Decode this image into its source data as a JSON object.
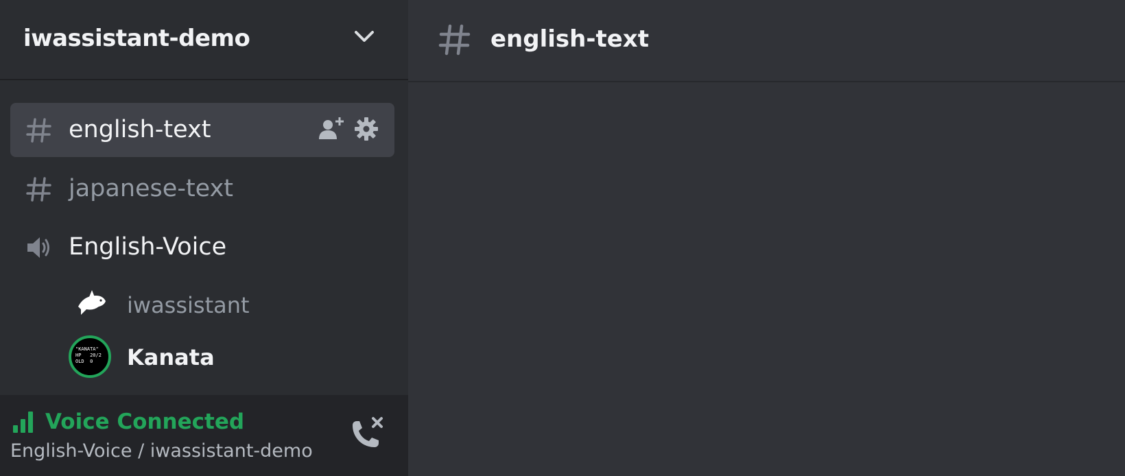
{
  "server": {
    "name": "iwassistant-demo"
  },
  "channels": [
    {
      "type": "text",
      "label": "english-text",
      "selected": true
    },
    {
      "type": "text",
      "label": "japanese-text",
      "selected": false
    },
    {
      "type": "voice",
      "label": "English-Voice",
      "selected": false
    }
  ],
  "voice_members": [
    {
      "name": "iwassistant",
      "speaking": false
    },
    {
      "name": "Kanata",
      "speaking": true,
      "avatar_text": "\"KANATA\"\nHP   20/2\nOLD  0"
    }
  ],
  "voice_panel": {
    "status": "Voice Connected",
    "location": "English-Voice / iwassistant-demo"
  },
  "main": {
    "channel_title": "english-text"
  },
  "colors": {
    "connected_green": "#23a55a",
    "sidebar_bg": "#2b2d31",
    "main_bg": "#313338",
    "selected_bg": "#404249"
  }
}
